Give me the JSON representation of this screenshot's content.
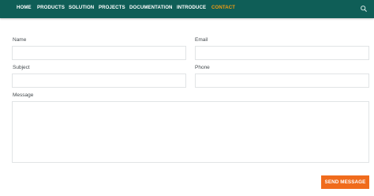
{
  "nav": {
    "items": [
      {
        "label": "HOME",
        "active": false
      },
      {
        "label": "PRODUCTS",
        "active": false
      },
      {
        "label": "SOLUTION",
        "active": false
      },
      {
        "label": "PROJECTS",
        "active": false
      },
      {
        "label": "DOCUMENTATION",
        "active": false
      },
      {
        "label": "INTRODUCE",
        "active": false
      },
      {
        "label": "CONTACT",
        "active": true
      }
    ],
    "search_icon": "search-icon",
    "background_color": "#0f5e57",
    "active_color": "#f39c12"
  },
  "form": {
    "name_label": "Name",
    "name_value": "",
    "email_label": "Email",
    "email_value": "",
    "subject_label": "Subject",
    "subject_value": "",
    "phone_label": "Phone",
    "phone_value": "",
    "message_label": "Message",
    "message_value": "",
    "send_label": "SEND MESSAGE",
    "send_color": "#f06b1c"
  }
}
